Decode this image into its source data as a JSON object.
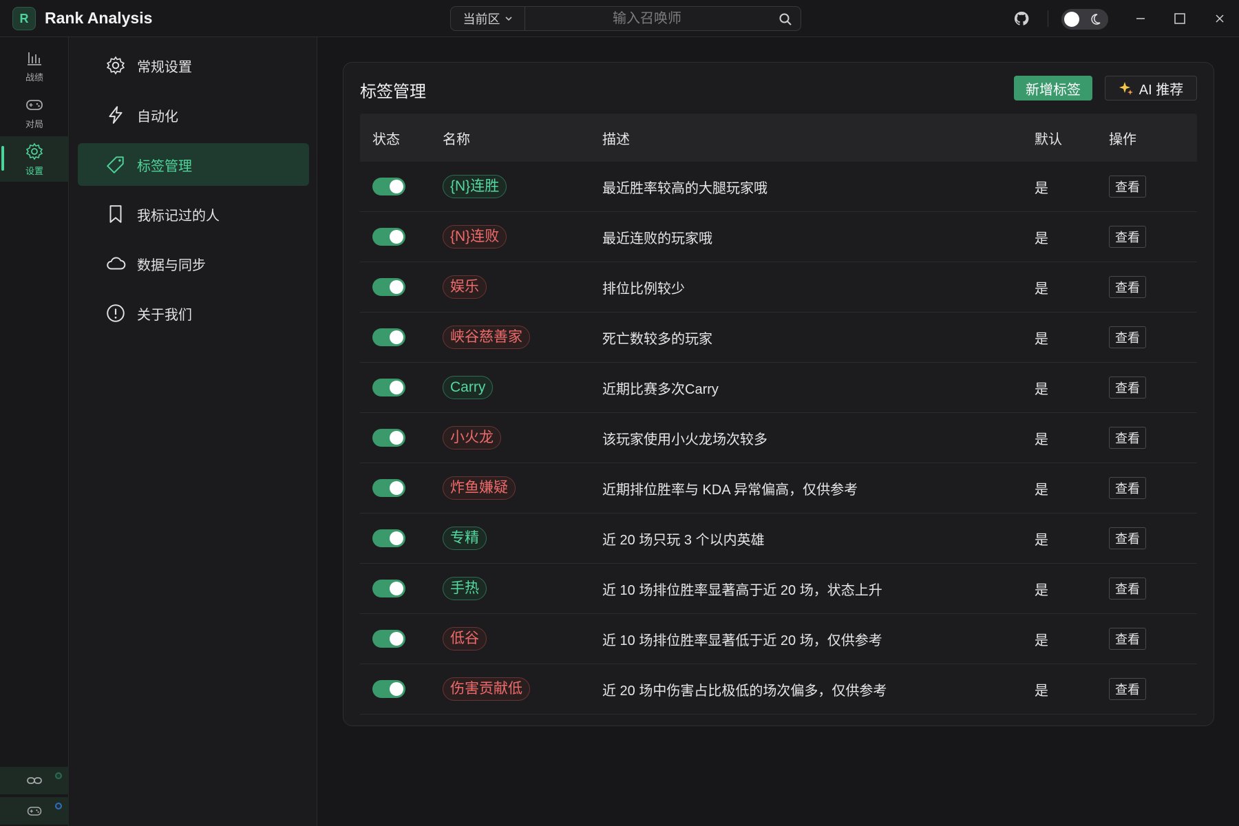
{
  "app": {
    "logo_letter": "R",
    "title": "Rank Analysis"
  },
  "search": {
    "region": "当前区",
    "placeholder": "输入召唤师"
  },
  "titlebar_icons": [
    "github-icon",
    "sun-moon-toggle",
    "minimize-icon",
    "maximize-icon",
    "close-icon"
  ],
  "rail": {
    "items": [
      {
        "label": "战绩",
        "icon": "bar-chart-icon",
        "active": false
      },
      {
        "label": "对局",
        "icon": "gamepad-icon",
        "active": false
      },
      {
        "label": "设置",
        "icon": "gear-icon",
        "active": true
      }
    ],
    "bottom": [
      {
        "icon": "link-icon",
        "status": "green"
      },
      {
        "icon": "gamepad-icon",
        "status": "blue"
      }
    ]
  },
  "settings_menu": [
    {
      "label": "常规设置",
      "icon": "gear-icon",
      "active": false
    },
    {
      "label": "自动化",
      "icon": "lightning-icon",
      "active": false
    },
    {
      "label": "标签管理",
      "icon": "tag-icon",
      "active": true
    },
    {
      "label": "我标记过的人",
      "icon": "bookmark-icon",
      "active": false
    },
    {
      "label": "数据与同步",
      "icon": "cloud-icon",
      "active": false
    },
    {
      "label": "关于我们",
      "icon": "info-icon",
      "active": false
    }
  ],
  "card": {
    "title": "标签管理",
    "add_button": "新增标签",
    "ai_button": "AI 推荐"
  },
  "table": {
    "headers": [
      "状态",
      "名称",
      "描述",
      "默认",
      "操作"
    ],
    "rows": [
      {
        "enabled": true,
        "name": "{N}连胜",
        "color": "green",
        "desc": "最近胜率较高的大腿玩家哦",
        "default": "是",
        "action": "查看"
      },
      {
        "enabled": true,
        "name": "{N}连败",
        "color": "red",
        "desc": "最近连败的玩家哦",
        "default": "是",
        "action": "查看"
      },
      {
        "enabled": true,
        "name": "娱乐",
        "color": "red",
        "desc": "排位比例较少",
        "default": "是",
        "action": "查看"
      },
      {
        "enabled": true,
        "name": "峡谷慈善家",
        "color": "red",
        "desc": "死亡数较多的玩家",
        "default": "是",
        "action": "查看"
      },
      {
        "enabled": true,
        "name": "Carry",
        "color": "green",
        "desc": "近期比赛多次Carry",
        "default": "是",
        "action": "查看"
      },
      {
        "enabled": true,
        "name": "小火龙",
        "color": "red",
        "desc": "该玩家使用小火龙场次较多",
        "default": "是",
        "action": "查看"
      },
      {
        "enabled": true,
        "name": "炸鱼嫌疑",
        "color": "red",
        "desc": "近期排位胜率与 KDA 异常偏高，仅供参考",
        "default": "是",
        "action": "查看"
      },
      {
        "enabled": true,
        "name": "专精",
        "color": "green",
        "desc": "近 20 场只玩 3 个以内英雄",
        "default": "是",
        "action": "查看"
      },
      {
        "enabled": true,
        "name": "手热",
        "color": "green",
        "desc": "近 10 场排位胜率显著高于近 20 场，状态上升",
        "default": "是",
        "action": "查看"
      },
      {
        "enabled": true,
        "name": "低谷",
        "color": "red",
        "desc": "近 10 场排位胜率显著低于近 20 场，仅供参考",
        "default": "是",
        "action": "查看"
      },
      {
        "enabled": true,
        "name": "伤害贡献低",
        "color": "red",
        "desc": "近 20 场中伤害占比极低的场次偏多，仅供参考",
        "default": "是",
        "action": "查看"
      }
    ]
  },
  "colors": {
    "accent": "#3a9a6c",
    "accent_text": "#4fd39a",
    "tag_green": "#55d8a0",
    "tag_red": "#ef6b6b",
    "background": "#18181a"
  }
}
